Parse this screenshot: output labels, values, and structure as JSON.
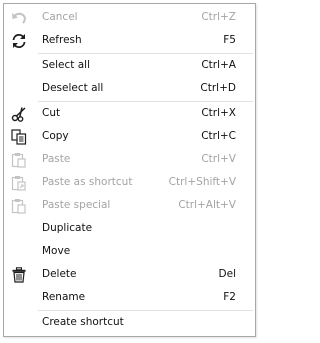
{
  "menu": {
    "items": [
      {
        "label": "Cancel",
        "shortcut": "Ctrl+Z",
        "icon": "undo-icon",
        "disabled": true
      },
      {
        "label": "Refresh",
        "shortcut": "F5",
        "icon": "refresh-icon",
        "disabled": false
      },
      {
        "label": "Select all",
        "shortcut": "Ctrl+A",
        "icon": "",
        "disabled": false
      },
      {
        "label": "Deselect all",
        "shortcut": "Ctrl+D",
        "icon": "",
        "disabled": false
      },
      {
        "label": "Cut",
        "shortcut": "Ctrl+X",
        "icon": "scissors-icon",
        "disabled": false
      },
      {
        "label": "Copy",
        "shortcut": "Ctrl+C",
        "icon": "copy-icon",
        "disabled": false
      },
      {
        "label": "Paste",
        "shortcut": "Ctrl+V",
        "icon": "paste-icon",
        "disabled": true
      },
      {
        "label": "Paste as shortcut",
        "shortcut": "Ctrl+Shift+V",
        "icon": "paste-shortcut-icon",
        "disabled": true
      },
      {
        "label": "Paste special",
        "shortcut": "Ctrl+Alt+V",
        "icon": "paste-special-icon",
        "disabled": true
      },
      {
        "label": "Duplicate",
        "shortcut": "",
        "icon": "",
        "disabled": false
      },
      {
        "label": "Move",
        "shortcut": "",
        "icon": "",
        "disabled": false
      },
      {
        "label": "Delete",
        "shortcut": "Del",
        "icon": "trash-icon",
        "disabled": false
      },
      {
        "label": "Rename",
        "shortcut": "F2",
        "icon": "",
        "disabled": false
      },
      {
        "label": "Create shortcut",
        "shortcut": "",
        "icon": "",
        "disabled": false
      }
    ]
  },
  "colors": {
    "disabled_text": "#a3a3a3",
    "text": "#111111",
    "separator": "#e2e2e2",
    "border": "#a8a8a8"
  }
}
